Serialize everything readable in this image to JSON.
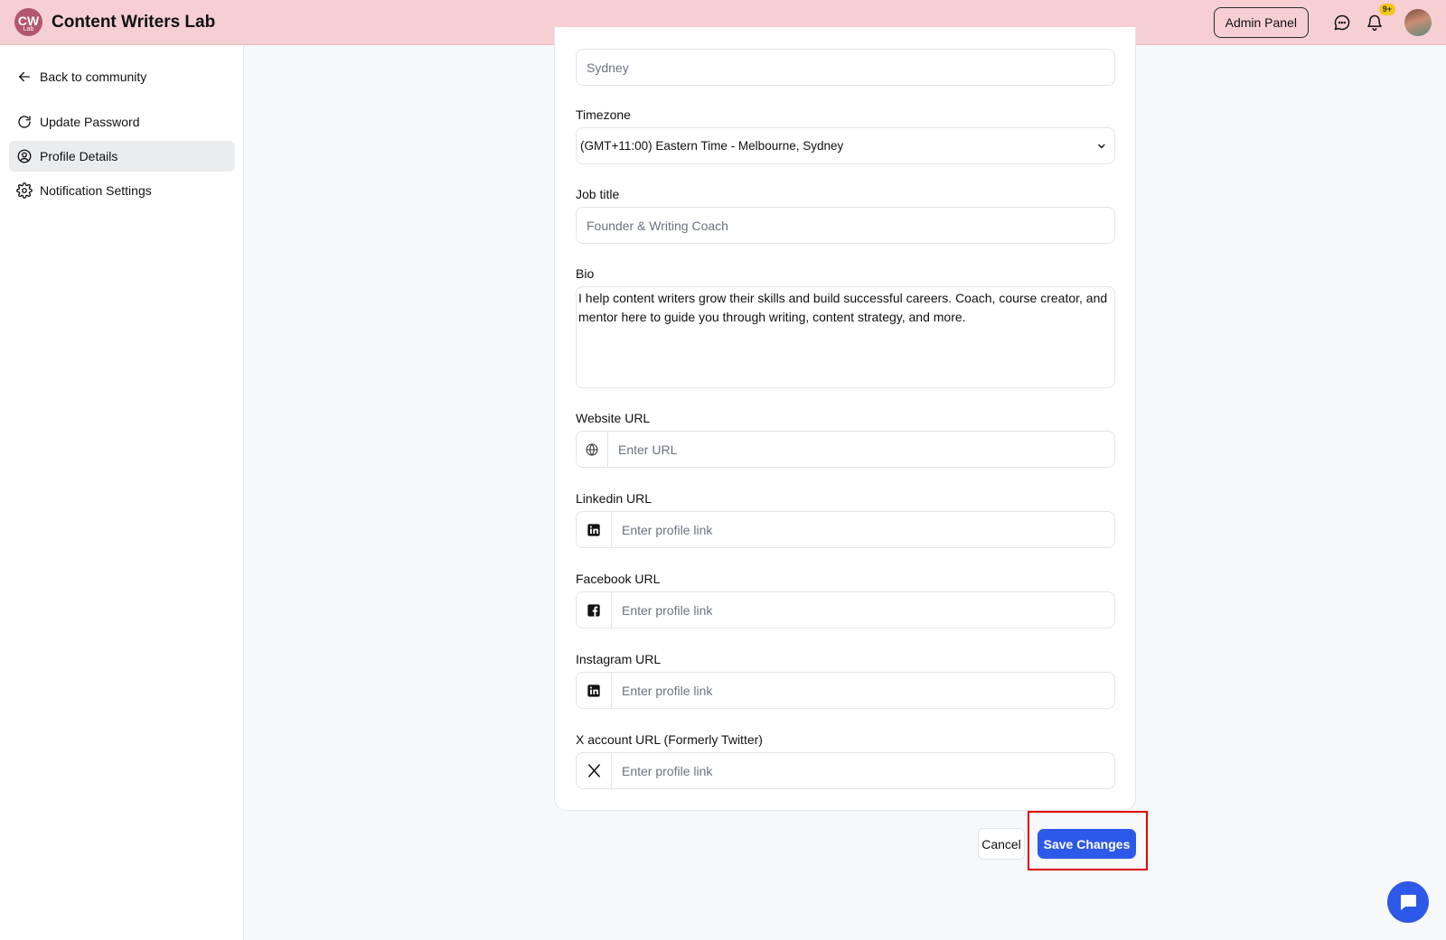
{
  "header": {
    "logo_top": "CW",
    "logo_bottom": "Lab",
    "brand": "Content Writers Lab",
    "admin_panel": "Admin Panel",
    "notification_badge": "9+"
  },
  "sidebar": {
    "back": "Back to community",
    "items": [
      {
        "label": "Update Password",
        "icon": "refresh-icon",
        "active": false
      },
      {
        "label": "Profile Details",
        "icon": "user-circle-icon",
        "active": true
      },
      {
        "label": "Notification Settings",
        "icon": "gear-icon",
        "active": false
      }
    ]
  },
  "form": {
    "city": {
      "value": "",
      "placeholder": "Sydney"
    },
    "timezone": {
      "label": "Timezone",
      "value": "(GMT+11:00) Eastern Time - Melbourne, Sydney"
    },
    "job_title": {
      "label": "Job title",
      "value": "",
      "placeholder": "Founder & Writing Coach"
    },
    "bio": {
      "label": "Bio",
      "value": "I help content writers grow their skills and build successful careers. Coach, course creator, and mentor here to guide you through writing, content strategy, and more."
    },
    "website": {
      "label": "Website URL",
      "placeholder": "Enter URL"
    },
    "linkedin": {
      "label": "Linkedin URL",
      "placeholder": "Enter profile link"
    },
    "facebook": {
      "label": "Facebook URL",
      "placeholder": "Enter profile link"
    },
    "instagram": {
      "label": "Instagram URL",
      "placeholder": "Enter profile link"
    },
    "x_account": {
      "label": "X account URL (Formerly Twitter)",
      "placeholder": "Enter profile link"
    }
  },
  "actions": {
    "cancel": "Cancel",
    "save": "Save Changes"
  },
  "colors": {
    "topbar": "#f6cfd3",
    "primary": "#2d59e8",
    "highlight": "#e00000"
  }
}
